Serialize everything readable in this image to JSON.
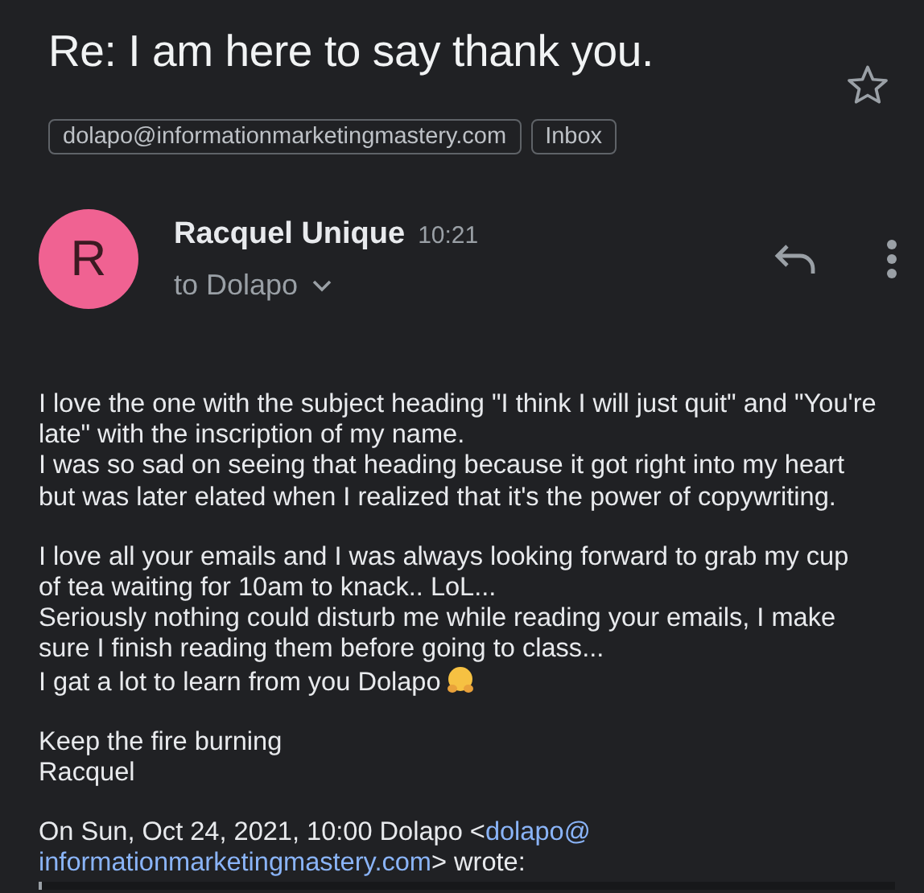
{
  "subject": "Re: I am here to say thank you.",
  "starred": false,
  "labels": [
    "dolapo@informationmarketingmastery.com",
    "Inbox"
  ],
  "sender": {
    "initial": "R",
    "name": "Racquel Unique",
    "time": "10:21",
    "recipient": "to Dolapo",
    "color": "#f06292"
  },
  "body": [
    [
      "I love the one with the subject heading \"I think I will just quit\" and \"You're",
      "late\" with the inscription of my name.",
      "I was so sad on seeing that heading because it got right into my heart",
      "but was later elated when I realized that it's the power of copywriting."
    ],
    [
      "I love all your emails and I was always looking forward to grab my cup",
      "of tea waiting for 10am to knack.. LoL...",
      "Seriously nothing could disturb me while reading your emails, I make",
      "sure I finish reading them before going to class...",
      "I gat a lot to learn from you Dolapo"
    ],
    [
      "Keep the fire burning",
      "Racquel"
    ]
  ],
  "quote_header": {
    "before": "On Sun, Oct 24, 2021, 10:00 Dolapo <",
    "link_lines": [
      "dolapo@",
      "informationmarketingmastery.com"
    ],
    "after": "> wrote:"
  }
}
